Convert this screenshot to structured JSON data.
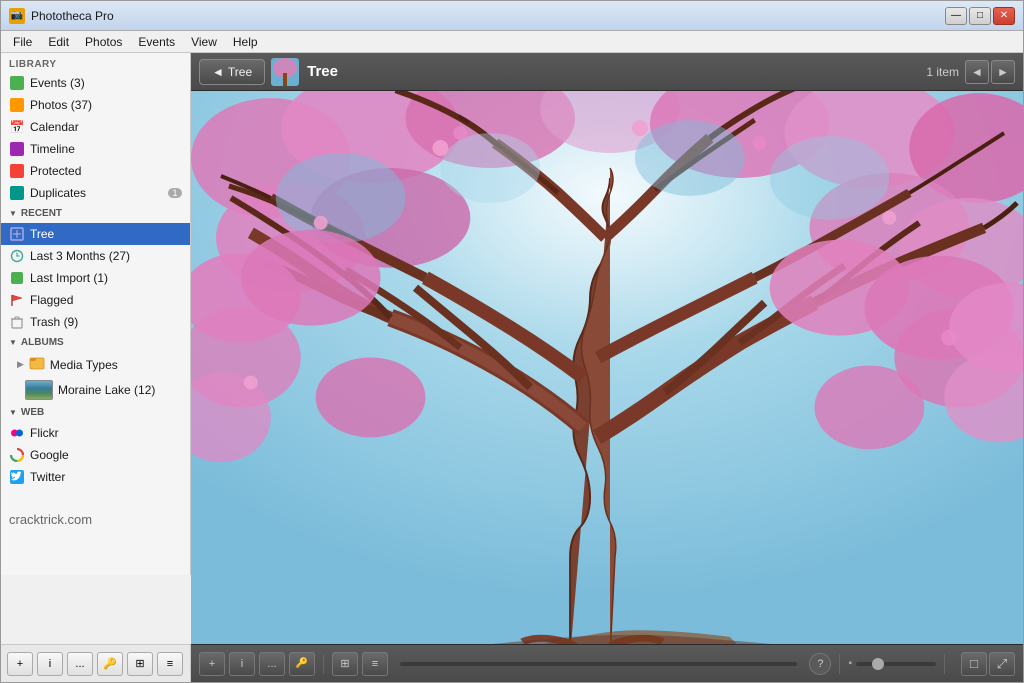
{
  "window": {
    "title": "Phototheca Pro",
    "icon": "📷"
  },
  "menu": {
    "items": [
      "File",
      "Edit",
      "Photos",
      "Events",
      "View",
      "Help"
    ]
  },
  "sidebar": {
    "library_header": "LIBRARY",
    "library_items": [
      {
        "id": "events",
        "label": "Events (3)",
        "icon": "calendar",
        "color": "green"
      },
      {
        "id": "photos",
        "label": "Photos (37)",
        "icon": "photo",
        "color": "orange"
      },
      {
        "id": "calendar",
        "label": "Calendar",
        "icon": "cal",
        "color": "orange"
      },
      {
        "id": "timeline",
        "label": "Timeline",
        "icon": "timeline",
        "color": "purple"
      },
      {
        "id": "protected",
        "label": "Protected",
        "icon": "shield",
        "color": "red"
      },
      {
        "id": "duplicates",
        "label": "Duplicates",
        "icon": "dup",
        "color": "teal",
        "badge": "1"
      }
    ],
    "recent_header": "RECENT",
    "recent_items": [
      {
        "id": "tree",
        "label": "Tree",
        "icon": "edit",
        "active": true
      },
      {
        "id": "last3months",
        "label": "Last 3 Months (27)",
        "icon": "clock"
      },
      {
        "id": "lastimport",
        "label": "Last Import (1)",
        "icon": "import"
      },
      {
        "id": "flagged",
        "label": "Flagged",
        "icon": "flag"
      },
      {
        "id": "trash",
        "label": "Trash (9)",
        "icon": "trash"
      }
    ],
    "albums_header": "ALBUMS",
    "albums_items": [
      {
        "id": "mediatypes",
        "label": "Media Types",
        "icon": "folder",
        "color": "yellow",
        "expandable": true
      },
      {
        "id": "morainelake",
        "label": "Moraine Lake (12)",
        "icon": "photo",
        "color": "mountain"
      }
    ],
    "web_header": "WEB",
    "web_items": [
      {
        "id": "flickr",
        "label": "Flickr",
        "icon": "flickr"
      },
      {
        "id": "google",
        "label": "Google",
        "icon": "google"
      },
      {
        "id": "twitter",
        "label": "Twitter",
        "icon": "twitter"
      }
    ],
    "watermark": "cracktrick.com"
  },
  "content": {
    "back_btn": "Tree",
    "album_title": "Tree",
    "item_count": "1 item",
    "nav_prev": "◄",
    "nav_next": "►"
  },
  "bottom_toolbar": {
    "add_label": "+",
    "info_label": "i",
    "more_label": "...",
    "key_label": "🔑",
    "grid_label": "⊞",
    "list_label": "≡",
    "help_label": "?",
    "view_single": "□",
    "view_full": "⤢"
  }
}
